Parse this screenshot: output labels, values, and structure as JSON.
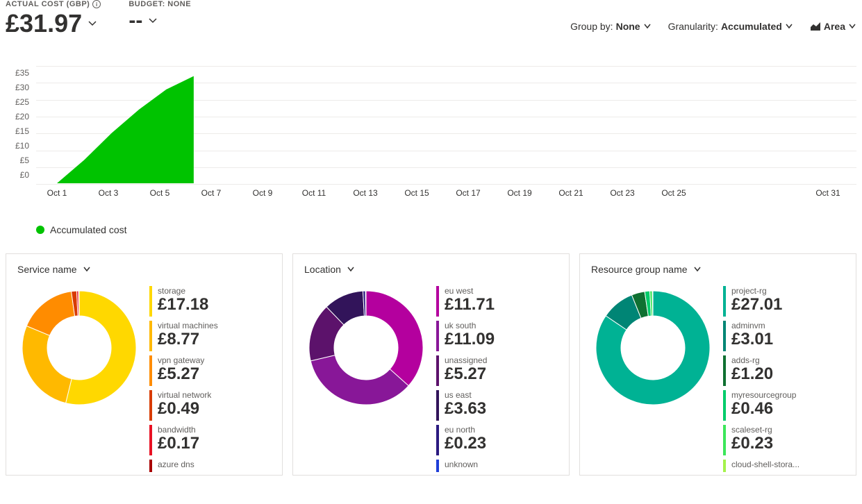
{
  "header": {
    "actual_label": "ACTUAL COST (GBP)",
    "actual_value": "£31.97",
    "budget_label": "BUDGET: NONE",
    "budget_value": "--"
  },
  "controls": {
    "group_by_label": "Group by:",
    "group_by_value": "None",
    "granularity_label": "Granularity:",
    "granularity_value": "Accumulated",
    "chart_type_value": "Area"
  },
  "chart_data": {
    "type": "area",
    "title": "",
    "xlabel": "",
    "ylabel": "",
    "ylim": [
      0,
      35
    ],
    "y_ticks": [
      "£35",
      "£30",
      "£25",
      "£20",
      "£15",
      "£10",
      "£5",
      "£0"
    ],
    "x_ticks": [
      "Oct 1",
      "Oct 3",
      "Oct 5",
      "Oct 7",
      "Oct 9",
      "Oct 11",
      "Oct 13",
      "Oct 15",
      "Oct 17",
      "Oct 19",
      "Oct 21",
      "Oct 23",
      "Oct 25",
      "Oct 31"
    ],
    "series": [
      {
        "name": "Accumulated cost",
        "color": "#00c300",
        "x": [
          "Oct 1",
          "Oct 2",
          "Oct 3",
          "Oct 4",
          "Oct 5",
          "Oct 6"
        ],
        "values": [
          0,
          7,
          15,
          22,
          28,
          31.97
        ]
      }
    ],
    "legend": "Accumulated cost"
  },
  "cards": [
    {
      "title": "Service name",
      "palette": "yellow",
      "items": [
        {
          "label": "storage",
          "value": "£17.18",
          "num": 17.18,
          "color": "#ffd800"
        },
        {
          "label": "virtual machines",
          "value": "£8.77",
          "num": 8.77,
          "color": "#ffb900"
        },
        {
          "label": "vpn gateway",
          "value": "£5.27",
          "num": 5.27,
          "color": "#ff8c00"
        },
        {
          "label": "virtual network",
          "value": "£0.49",
          "num": 0.49,
          "color": "#d83b01"
        },
        {
          "label": "bandwidth",
          "value": "£0.17",
          "num": 0.17,
          "color": "#e81123"
        },
        {
          "label": "azure dns",
          "value": "",
          "num": 0.05,
          "color": "#a80000"
        }
      ]
    },
    {
      "title": "Location",
      "palette": "purple",
      "items": [
        {
          "label": "eu west",
          "value": "£11.71",
          "num": 11.71,
          "color": "#b4009e"
        },
        {
          "label": "uk south",
          "value": "£11.09",
          "num": 11.09,
          "color": "#881798"
        },
        {
          "label": "unassigned",
          "value": "£5.27",
          "num": 5.27,
          "color": "#5c126b"
        },
        {
          "label": "us east",
          "value": "£3.63",
          "num": 3.63,
          "color": "#32145a"
        },
        {
          "label": "eu north",
          "value": "£0.23",
          "num": 0.23,
          "color": "#2b1a80"
        },
        {
          "label": "unknown",
          "value": "",
          "num": 0.05,
          "color": "#1f3ed8"
        }
      ]
    },
    {
      "title": "Resource group name",
      "palette": "teal",
      "items": [
        {
          "label": "project-rg",
          "value": "£27.01",
          "num": 27.01,
          "color": "#00b294"
        },
        {
          "label": "adminvm",
          "value": "£3.01",
          "num": 3.01,
          "color": "#008575"
        },
        {
          "label": "adds-rg",
          "value": "£1.20",
          "num": 1.2,
          "color": "#0f7031"
        },
        {
          "label": "myresourcegroup",
          "value": "£0.46",
          "num": 0.46,
          "color": "#00cc6a"
        },
        {
          "label": "scaleset-rg",
          "value": "£0.23",
          "num": 0.23,
          "color": "#3ce65a"
        },
        {
          "label": "cloud-shell-stora...",
          "value": "",
          "num": 0.05,
          "color": "#a4f24b"
        }
      ]
    }
  ]
}
